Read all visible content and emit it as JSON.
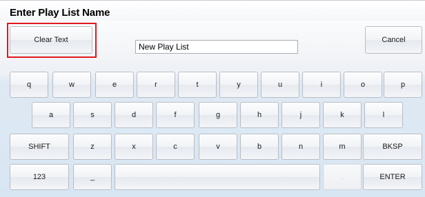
{
  "dialog": {
    "title": "Enter Play List Name"
  },
  "top": {
    "clear_label": "Clear Text",
    "cancel_label": "Cancel",
    "name_value": "New Play List"
  },
  "keyboard": {
    "row1": [
      "q",
      "w",
      "e",
      "r",
      "t",
      "y",
      "u",
      "i",
      "o",
      "p"
    ],
    "row2": [
      "a",
      "s",
      "d",
      "f",
      "g",
      "h",
      "j",
      "k",
      "l"
    ],
    "row3": [
      "SHIFT",
      "z",
      "x",
      "c",
      "v",
      "b",
      "n",
      "m",
      "BKSP"
    ],
    "row4": {
      "numbers": "123",
      "underscore": "_",
      "space": "",
      "dot": ".",
      "enter": "ENTER"
    }
  },
  "colors": {
    "highlight": "#e0191c",
    "panel": "#d8e6f3"
  }
}
